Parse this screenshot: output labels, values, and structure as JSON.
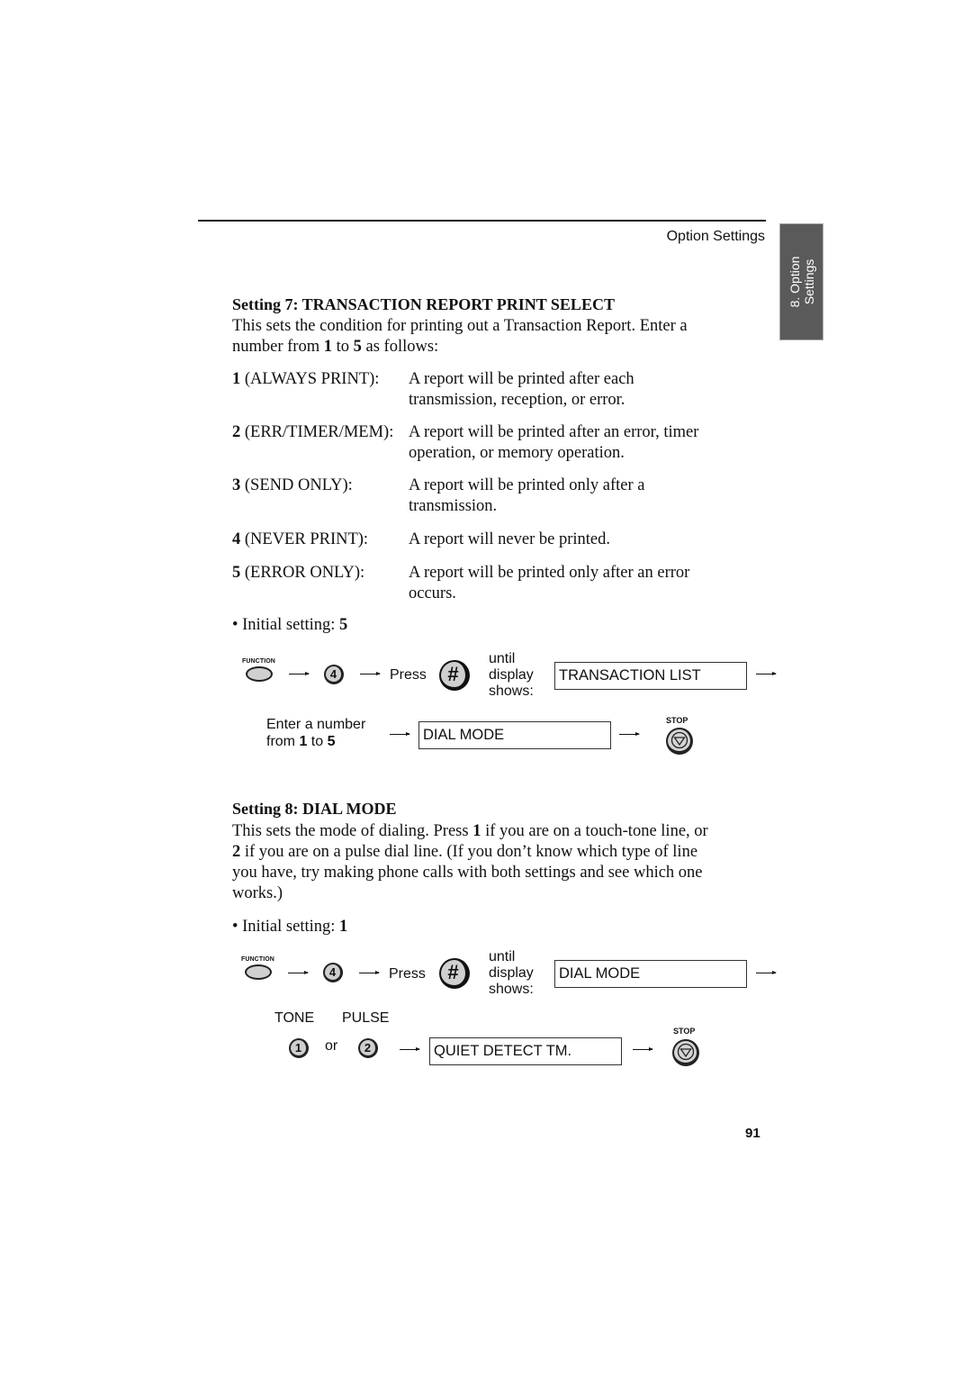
{
  "header": {
    "running_head": "Option Settings",
    "side_tab": {
      "line1": "8. Option",
      "line2": "Settings"
    }
  },
  "setting7": {
    "heading": "Setting 7: TRANSACTION REPORT PRINT SELECT",
    "intro_a": "This sets the condition for printing out a Transaction Report. Enter a",
    "intro_b_pre": "number from ",
    "intro_b_n1": "1",
    "intro_b_mid": " to ",
    "intro_b_n2": "5",
    "intro_b_post": " as follows:",
    "options": [
      {
        "num": "1",
        "key": " (ALWAYS PRINT):",
        "desc": "A report will be printed after each transmission, reception, or error."
      },
      {
        "num": "2",
        "key": " (ERR/TIMER/MEM):",
        "desc": "A report will be printed after an error, timer operation, or memory operation."
      },
      {
        "num": "3",
        "key": " (SEND ONLY):",
        "desc": "A report will be printed only after a transmission."
      },
      {
        "num": "4",
        "key": " (NEVER PRINT):",
        "desc": "A report will never be printed."
      },
      {
        "num": "5",
        "key": " (ERROR ONLY):",
        "desc": "A report will be printed only after an error occurs."
      }
    ],
    "initial_label": "• Initial setting: ",
    "initial_value": "5",
    "diagram": {
      "function_label": "FUNCTION",
      "key_4": "4",
      "press": "Press",
      "hash": "#",
      "until": "until",
      "display": "display",
      "shows": "shows:",
      "display_1": "TRANSACTION LIST",
      "enter_line1": "Enter a number",
      "enter_from": "from ",
      "enter_n1": "1",
      "enter_to": " to ",
      "enter_n2": "5",
      "display_2": "DIAL MODE",
      "stop_label": "STOP"
    }
  },
  "setting8": {
    "heading": "Setting 8: DIAL MODE",
    "body_l1_pre": "This sets the mode of dialing. Press ",
    "body_l1_n": "1",
    "body_l1_post": " if you are on a touch-tone line, or",
    "body_l2_n": "2",
    "body_l2_post": " if you are on a pulse dial line. (If you don’t know which type of line",
    "body_l3": "you have, try making phone calls with both settings and see which one",
    "body_l4": "works.)",
    "initial_label": "• Initial setting: ",
    "initial_value": "1",
    "diagram": {
      "function_label": "FUNCTION",
      "key_4": "4",
      "press": "Press",
      "hash": "#",
      "until": "until",
      "display": "display",
      "shows": "shows:",
      "display_1": "DIAL MODE",
      "tone": "TONE",
      "pulse": "PULSE",
      "key_1": "1",
      "or": "or",
      "key_2": "2",
      "display_2": "QUIET DETECT TM.",
      "stop_label": "STOP"
    }
  },
  "footer": {
    "page_number": "91"
  }
}
